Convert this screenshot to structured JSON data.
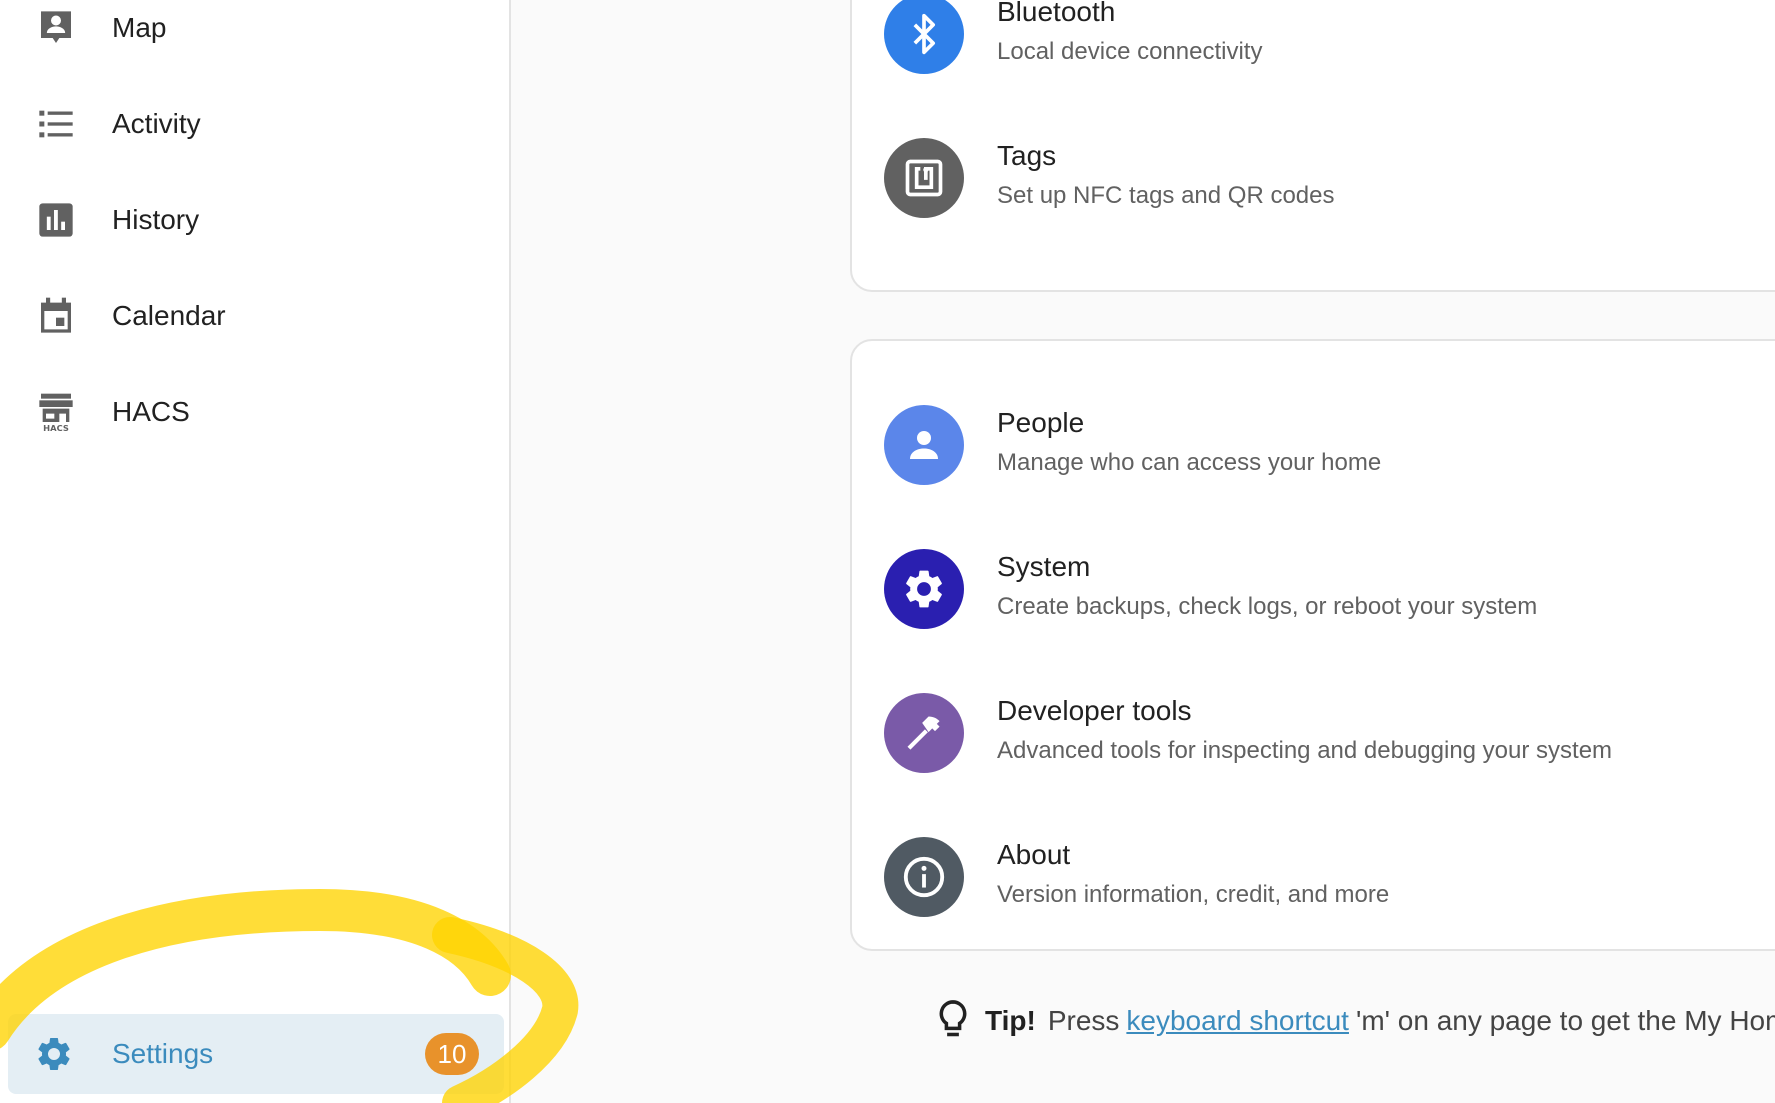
{
  "sidebar": {
    "items": [
      {
        "label": "Map",
        "icon": "map-account-icon"
      },
      {
        "label": "Activity",
        "icon": "activity-list-icon"
      },
      {
        "label": "History",
        "icon": "history-chart-icon"
      },
      {
        "label": "Calendar",
        "icon": "calendar-icon"
      },
      {
        "label": "HACS",
        "icon": "hacs-store-icon",
        "icon_text": "HACS"
      }
    ],
    "settings": {
      "label": "Settings",
      "badge": "10",
      "icon": "gear-icon"
    }
  },
  "cards": {
    "top": [
      {
        "title": "Bluetooth",
        "subtitle": "Local device connectivity",
        "icon": "bluetooth-icon",
        "color": "#2f7fe8"
      },
      {
        "title": "Tags",
        "subtitle": "Set up NFC tags and QR codes",
        "icon": "nfc-tag-icon",
        "color": "#616161"
      }
    ],
    "bottom": [
      {
        "title": "People",
        "subtitle": "Manage who can access your home",
        "icon": "person-icon",
        "color": "#5b86ea"
      },
      {
        "title": "System",
        "subtitle": "Create backups, check logs, or reboot your system",
        "icon": "gear-icon",
        "color": "#2a1fb0"
      },
      {
        "title": "Developer tools",
        "subtitle": "Advanced tools for inspecting and debugging your system",
        "icon": "hammer-icon",
        "color": "#7a5aa8"
      },
      {
        "title": "About",
        "subtitle": "Version information, credit, and more",
        "icon": "info-icon",
        "color": "#505a63"
      }
    ]
  },
  "tip": {
    "bold": "Tip!",
    "prefix": "Press",
    "link": "keyboard shortcut",
    "suffix": "'m' on any page to get the My Hom"
  },
  "colors": {
    "accent": "#3b8bbd",
    "badge": "#e8922b",
    "highlight_stroke": "#ffd400"
  }
}
